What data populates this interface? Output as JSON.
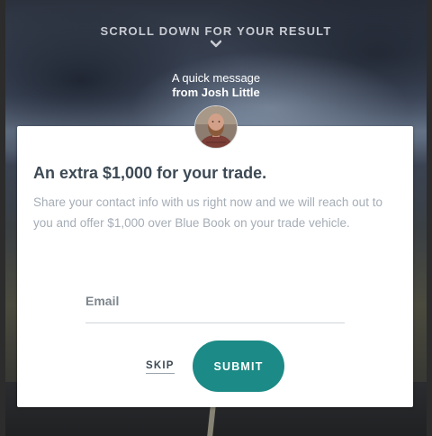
{
  "banner": {
    "scroll_hint": "SCROLL DOWN FOR YOUR RESULT",
    "chevron_icon": "chevron-down-icon"
  },
  "message": {
    "line1": "A quick message",
    "line2": "from Josh Little"
  },
  "avatar": {
    "icon": "person-portrait"
  },
  "offer": {
    "headline": "An extra $1,000 for your trade.",
    "body": "Share your contact info with us right now and we will reach out to you and offer $1,000 over Blue Book on your trade vehicle."
  },
  "form": {
    "email_value": "",
    "email_placeholder": "Email",
    "skip_label": "SKIP",
    "submit_label": "SUBMIT"
  },
  "colors": {
    "accent": "#1c8a86",
    "headline": "#3d4a55",
    "body": "#a5adb6"
  }
}
